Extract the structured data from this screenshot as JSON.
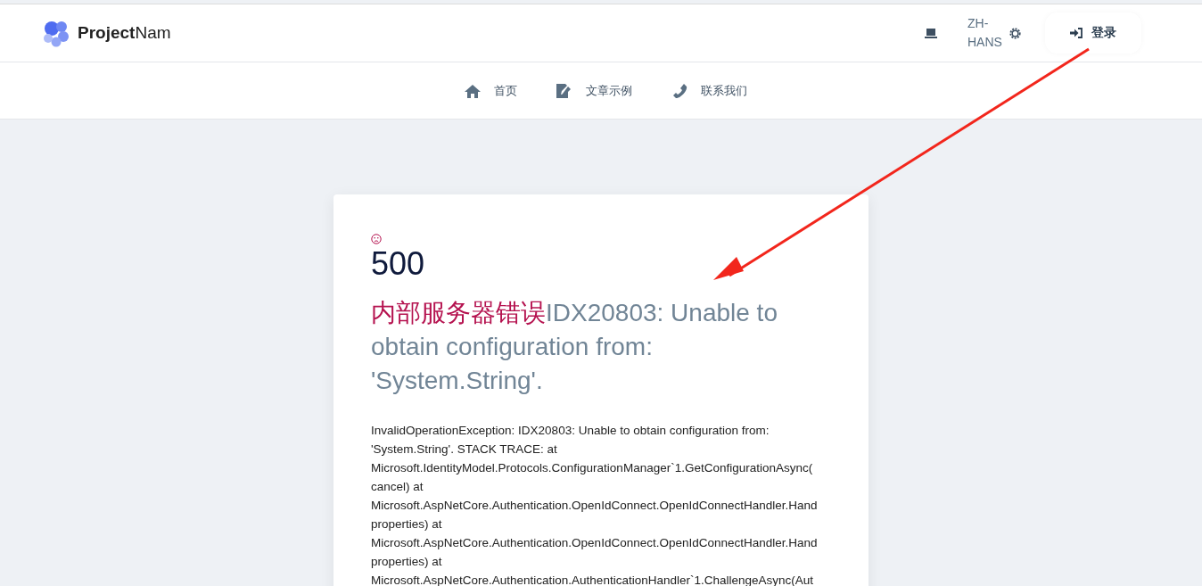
{
  "header": {
    "brand": "**Project**Nam",
    "language": "ZH-HANS",
    "login": "登录"
  },
  "nav": [
    {
      "label": "首页"
    },
    {
      "label": "文章示例"
    },
    {
      "label": "联系我们"
    }
  ],
  "error": {
    "code": "500",
    "title": "内部服务器错误",
    "message": "IDX20803: Unable to obtain configuration from: 'System.String'.",
    "trace": [
      "InvalidOperationException: IDX20803: Unable to obtain configuration from:",
      "'System.String'. STACK TRACE: at",
      "Microsoft.IdentityModel.Protocols.ConfigurationManager`1.GetConfigurationAsync(",
      "cancel) at",
      "Microsoft.AspNetCore.Authentication.OpenIdConnect.OpenIdConnectHandler.Hand",
      "properties) at",
      "Microsoft.AspNetCore.Authentication.OpenIdConnect.OpenIdConnectHandler.Hand",
      "properties) at",
      "Microsoft.AspNetCore.Authentication.AuthenticationHandler`1.ChallengeAsync(Aut"
    ]
  }
}
